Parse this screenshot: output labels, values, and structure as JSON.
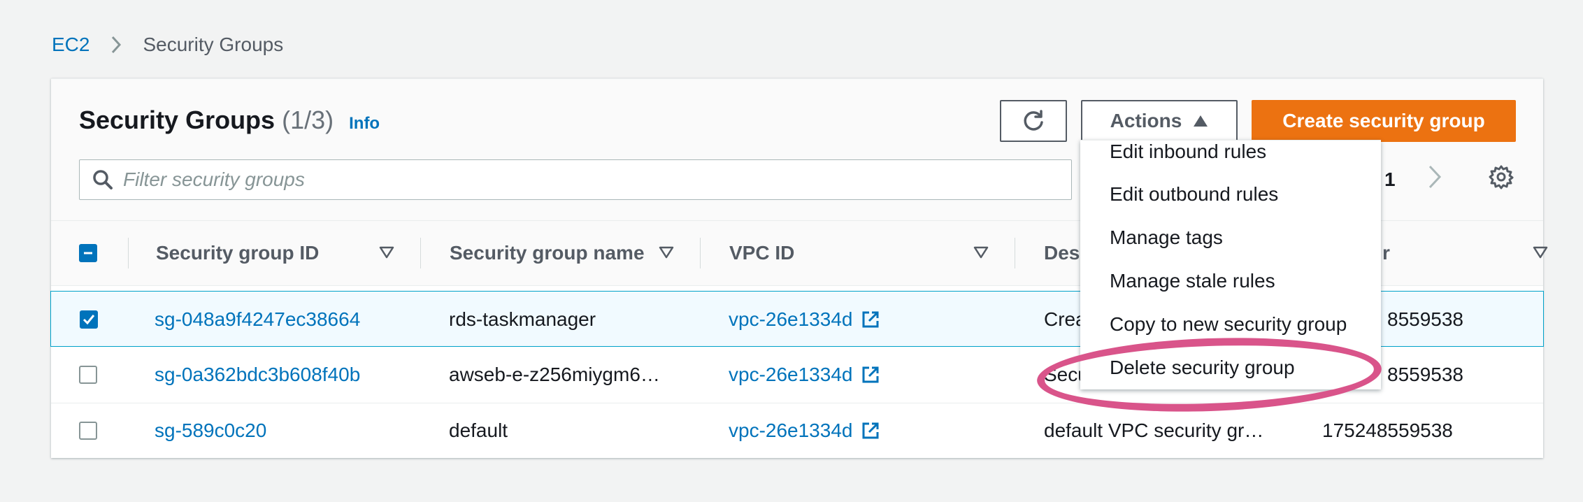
{
  "breadcrumb": {
    "root": "EC2",
    "current": "Security Groups"
  },
  "panel": {
    "title": "Security Groups",
    "count": "(1/3)",
    "info": "Info",
    "actions_label": "Actions",
    "create_label": "Create security group",
    "filter_placeholder": "Filter security groups",
    "page_number": "1"
  },
  "columns": [
    "Security group ID",
    "Security group name",
    "VPC ID",
    "Desc",
    "r"
  ],
  "rows": [
    {
      "id": "sg-048a9f4247ec38664",
      "name": "rds-taskmanager",
      "vpc": "vpc-26e1334d",
      "desc": "Crea",
      "owner": "8559538",
      "selected": true
    },
    {
      "id": "sg-0a362bdc3b608f40b",
      "name": "awseb-e-z256miygm6…",
      "vpc": "vpc-26e1334d",
      "desc": "Secu",
      "owner": "8559538",
      "selected": false
    },
    {
      "id": "sg-589c0c20",
      "name": "default",
      "vpc": "vpc-26e1334d",
      "desc": "default VPC security gr…",
      "owner": "175248559538",
      "selected": false
    }
  ],
  "actions_menu": [
    "Edit inbound rules",
    "Edit outbound rules",
    "Manage tags",
    "Manage stale rules",
    "Copy to new security group",
    "Delete security group"
  ],
  "colors": {
    "link": "#0073bb",
    "primary": "#ec7211",
    "highlight": "#d9548a"
  },
  "icons": [
    "chevron-right-icon",
    "refresh-icon",
    "caret-up-icon",
    "search-icon",
    "settings-gear-icon",
    "sort-caret-icon",
    "external-link-icon",
    "checkbox-icon"
  ]
}
